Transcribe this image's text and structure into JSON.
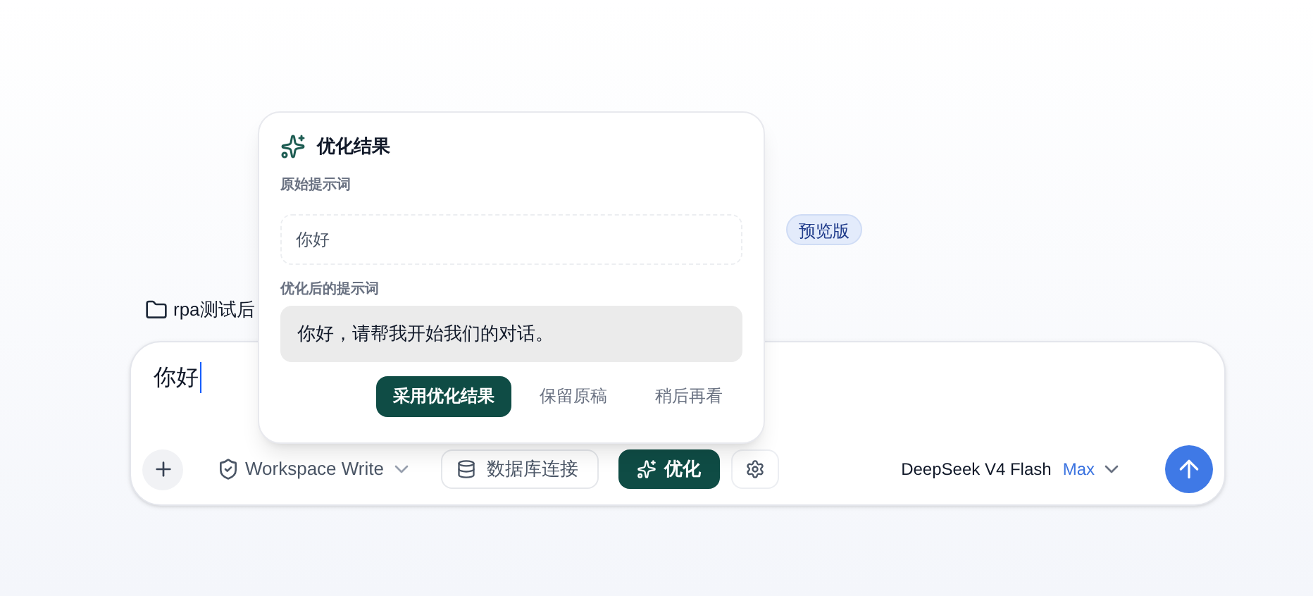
{
  "header": {
    "badge": "预览版"
  },
  "folder": {
    "label": "rpa测试后"
  },
  "composer": {
    "value": "你好",
    "toolbar": {
      "mode": "Workspace Write",
      "database": "数据库连接",
      "optimize": "优化",
      "model": "DeepSeek V4 Flash",
      "effort": "Max"
    }
  },
  "popup": {
    "title": "优化结果",
    "original_label": "原始提示词",
    "original": "你好",
    "optimized_label": "优化后的提示词",
    "optimized": "你好，请帮我开始我们的对话。",
    "actions": [
      {
        "label": "采用优化结果",
        "kind": "primary"
      },
      {
        "label": "保留原稿",
        "kind": "plain"
      },
      {
        "label": "稍后再看",
        "kind": "plain"
      }
    ]
  }
}
